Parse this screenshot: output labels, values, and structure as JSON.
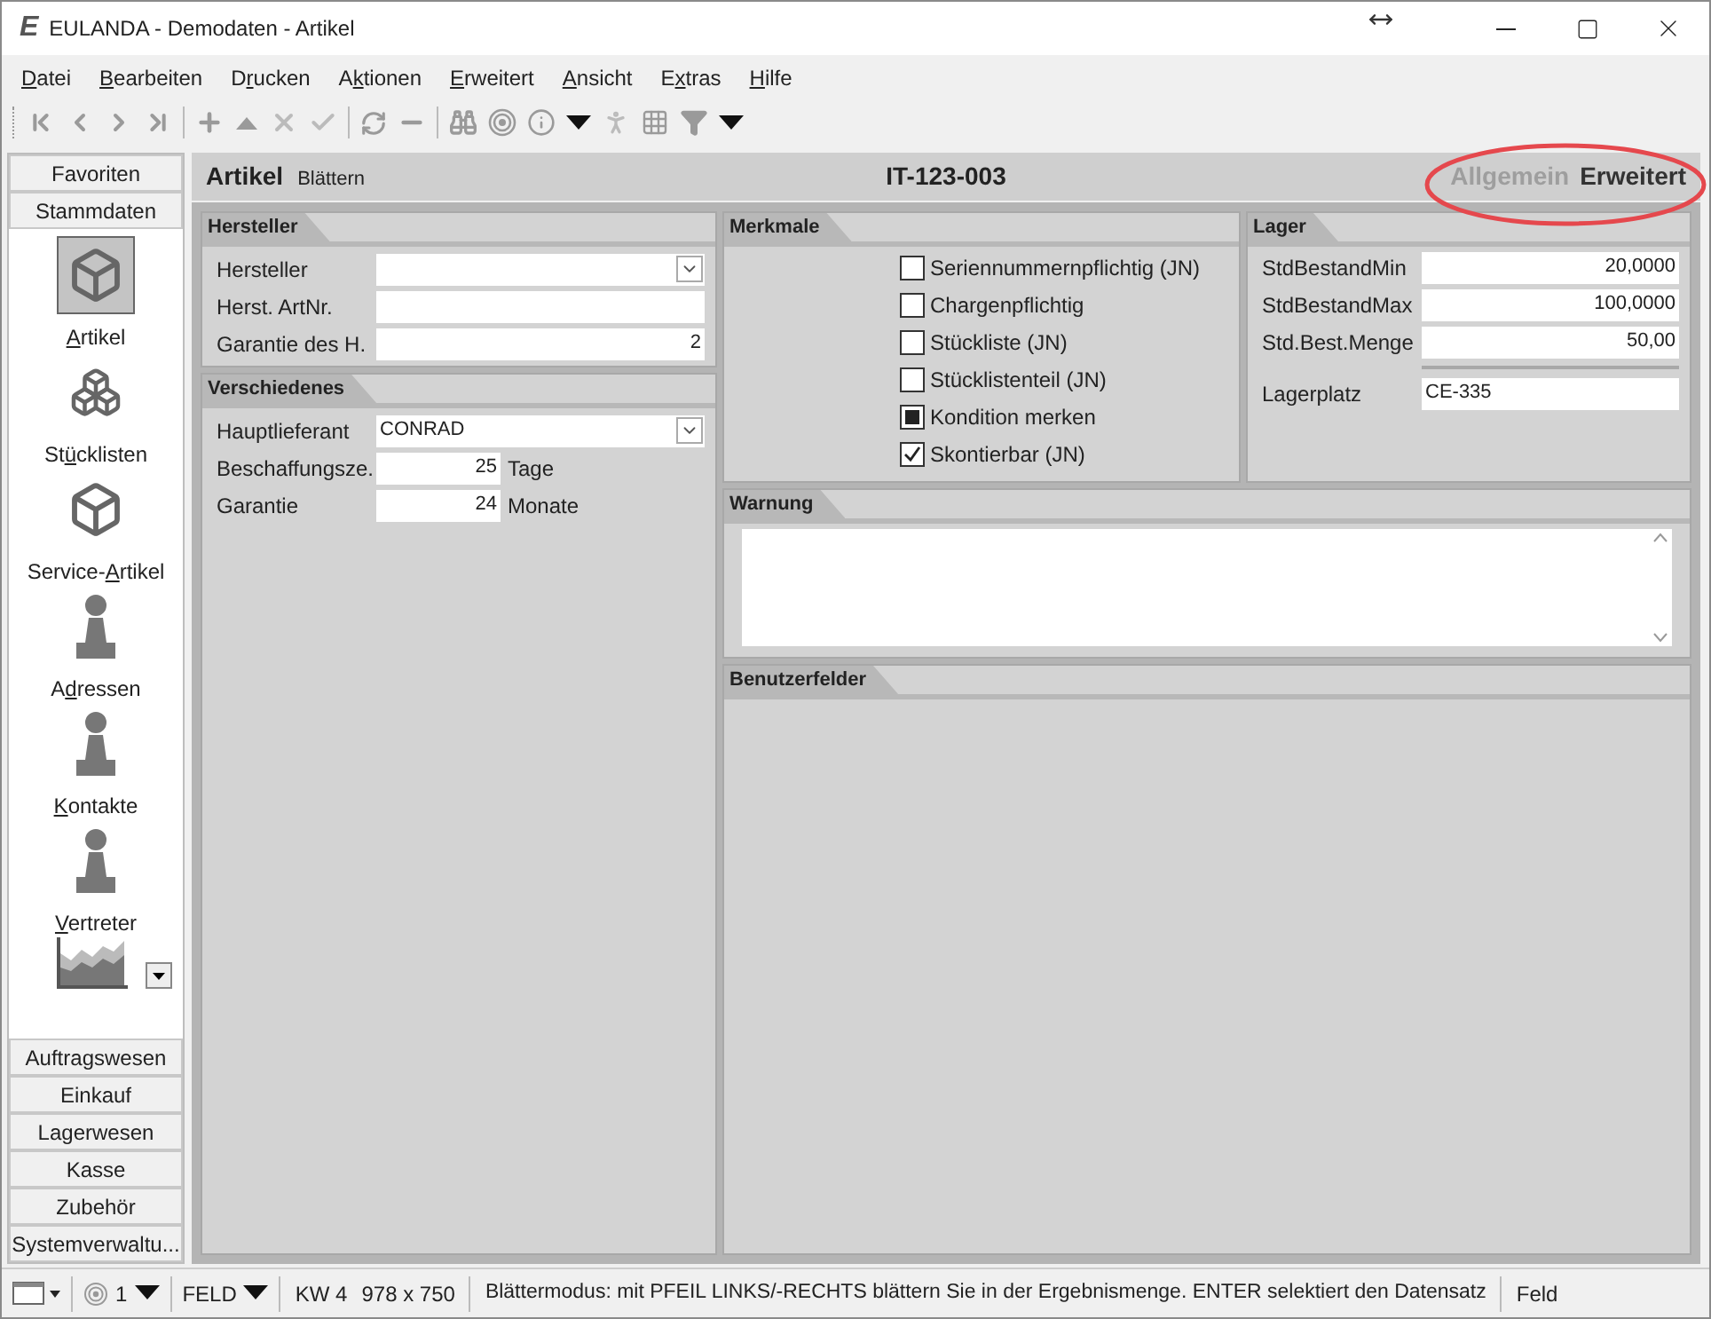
{
  "window": {
    "title": "EULANDA - Demodaten - Artikel",
    "logo": "E"
  },
  "menu": [
    {
      "key": "D",
      "post": "atei"
    },
    {
      "key": "B",
      "post": "earbeiten"
    },
    {
      "pre": "D",
      "key": "r",
      "post": "ucken"
    },
    {
      "pre": "A",
      "key": "k",
      "post": "tionen"
    },
    {
      "key": "E",
      "post": "rweitert"
    },
    {
      "key": "A",
      "post": "nsicht"
    },
    {
      "pre": "E",
      "key": "x",
      "post": "tras"
    },
    {
      "key": "H",
      "post": "ilfe"
    }
  ],
  "sidebar": {
    "top_groups": [
      {
        "label": "Favoriten"
      },
      {
        "label": "Stammdaten"
      }
    ],
    "items": [
      {
        "kind": "cube",
        "key": "A",
        "post": "rtikel",
        "selected": true
      },
      {
        "kind": "cubes",
        "pre": "St",
        "key": "ü",
        "post": "cklisten",
        "selected": false
      },
      {
        "kind": "cube",
        "pre": "Service-",
        "key": "A",
        "post": "rtikel",
        "selected": false
      },
      {
        "kind": "pawn",
        "pre": "A",
        "key": "d",
        "post": "ressen",
        "selected": false
      },
      {
        "kind": "pawn",
        "key": "K",
        "post": "ontakte",
        "selected": false
      },
      {
        "kind": "pawn",
        "key": "V",
        "post": "ertreter",
        "selected": false
      }
    ],
    "bottom_groups": [
      {
        "label": "Auftragswesen"
      },
      {
        "label": "Einkauf"
      },
      {
        "label": "Lagerwesen"
      },
      {
        "label": "Kasse"
      },
      {
        "label": "Zubehör"
      },
      {
        "label": "Systemverwaltu..."
      }
    ]
  },
  "header": {
    "title": "Artikel",
    "mode": "Blättern",
    "record": "IT-123-003",
    "tabs": [
      {
        "label": "Allgemein",
        "selected": false
      },
      {
        "label": "Erweitert",
        "selected": true
      }
    ]
  },
  "annotation": {
    "kind": "ellipse",
    "color": "#e5484d"
  },
  "hersteller": {
    "title": "Hersteller",
    "fields": [
      {
        "kind": "combo",
        "label": "Hersteller"
      },
      {
        "kind": "text",
        "label": "Herst. ArtNr."
      },
      {
        "kind": "number",
        "label": "Garantie des H.",
        "value": "2"
      }
    ]
  },
  "verschiedenes": {
    "title": "Verschiedenes",
    "fields": [
      {
        "kind": "combo",
        "label": "Hauptlieferant",
        "value": "CONRAD"
      },
      {
        "kind": "number",
        "label": "Beschaffungsze.",
        "value": "25",
        "unit": "Tage"
      },
      {
        "kind": "number",
        "label": "Garantie",
        "value": "24",
        "unit": "Monate"
      }
    ]
  },
  "merkmale": {
    "title": "Merkmale",
    "checkboxes": [
      {
        "kind": "tick",
        "label": "Seriennummernpflichtig (JN)",
        "checked": false
      },
      {
        "kind": "tick",
        "label": "Chargenpflichtig",
        "checked": false
      },
      {
        "kind": "tick",
        "label": "Stückliste (JN)",
        "checked": false
      },
      {
        "kind": "tick",
        "label": "Stücklistenteil (JN)",
        "checked": false
      },
      {
        "kind": "square",
        "label": "Kondition merken",
        "checked": true
      },
      {
        "kind": "tick",
        "label": "Skontierbar (JN)",
        "checked": true
      }
    ]
  },
  "lager": {
    "title": "Lager",
    "fields": [
      {
        "kind": "number",
        "label": "StdBestandMin",
        "value": "20,0000"
      },
      {
        "kind": "number",
        "label": "StdBestandMax",
        "value": "100,0000"
      },
      {
        "kind": "number",
        "label": "Std.Best.Menge",
        "value": "50,00"
      },
      {
        "kind": "separator"
      },
      {
        "kind": "text",
        "label": "Lagerplatz",
        "value": "CE-335"
      }
    ]
  },
  "warnung": {
    "title": "Warnung"
  },
  "benutzerfelder": {
    "title": "Benutzerfelder"
  },
  "status_bar": {
    "page": "1",
    "field_mode": "FELD",
    "week": "KW 4",
    "size": "978 x 750",
    "message": "Blättermodus: mit PFEIL LINKS/-RECHTS blättern Sie in der Ergebnismenge. ENTER selektiert den Datensatz",
    "field": "Feld"
  }
}
